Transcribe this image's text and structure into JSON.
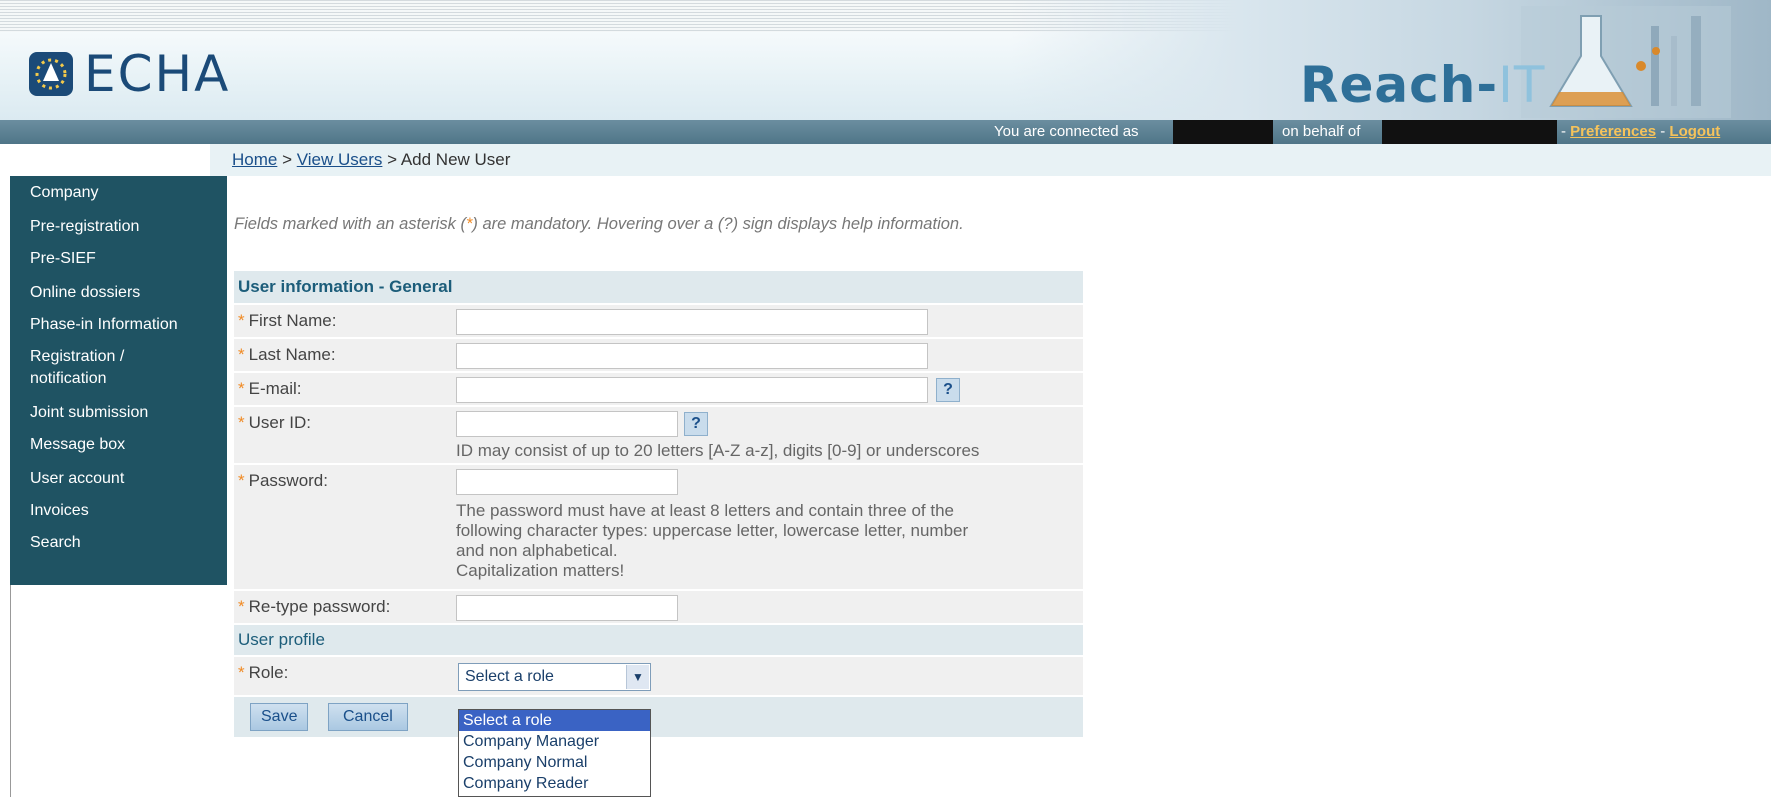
{
  "header": {
    "logo_text": "ECHA",
    "product_text_main": "Reach-",
    "product_text_it": "IT",
    "connected_as_label": "You are connected as",
    "on_behalf_label": "on behalf of",
    "preferences_link": "Preferences",
    "logout_link": "Logout",
    "separator": " - "
  },
  "breadcrumb": {
    "home": "Home",
    "sep": " > ",
    "view_users": "View Users",
    "current": "Add New User"
  },
  "sidebar": {
    "items": [
      {
        "label": "Company"
      },
      {
        "label": "Pre-registration"
      },
      {
        "label": "Pre-SIEF"
      },
      {
        "label": "Online dossiers"
      },
      {
        "label": "Phase-in Information"
      },
      {
        "label": "Registration / notification"
      },
      {
        "label": "Joint submission"
      },
      {
        "label": "Message box"
      },
      {
        "label": "User account"
      },
      {
        "label": "Invoices"
      },
      {
        "label": "Search"
      }
    ]
  },
  "instructions": {
    "before": "Fields marked with an asterisk (",
    "asterisk": "*",
    "after": ") are mandatory. Hovering over a (?) sign displays help information."
  },
  "form": {
    "general_title": "User information - General",
    "first_name_label": "First Name:",
    "last_name_label": "Last Name:",
    "email_label": "E-mail:",
    "user_id_label": "User ID:",
    "user_id_hint": "ID may consist of up to 20 letters [A-Z a-z], digits [0-9] or underscores",
    "password_label": "Password:",
    "password_hint_1": "The password must have at least 8 letters and contain three of the",
    "password_hint_2": "following character types: uppercase letter, lowercase letter, number",
    "password_hint_3": "and non alphabetical.",
    "password_hint_4": "Capitalization matters!",
    "retype_label": "Re-type password:",
    "profile_title": "User profile",
    "role_label": "Role:",
    "role_selected": "Select a role",
    "role_options": [
      "Select a role",
      "Company Manager",
      "Company Normal",
      "Company Reader"
    ],
    "help_symbol": "?",
    "asterisk": "*",
    "save_label": "Save",
    "cancel_label": "Cancel"
  },
  "colors": {
    "sidebar_bg": "#1f5363",
    "section_title": "#1c5d7a",
    "link": "#1a4f8a",
    "asterisk": "#f08a24",
    "header_links": "#f6c35b",
    "dropdown_highlight": "#3a63c4"
  }
}
